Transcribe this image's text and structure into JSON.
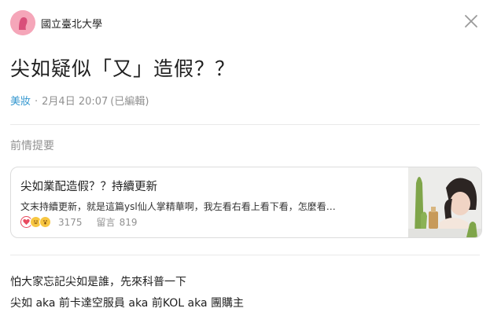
{
  "board": {
    "name": "國立臺北大學"
  },
  "post": {
    "title": "尖如疑似「又」造假？？",
    "category": "美妝",
    "separator": "·",
    "date": "2月4日 20:07",
    "edited": "(已編輯)"
  },
  "section": {
    "label": "前情提要"
  },
  "linked_post": {
    "title": "尖如業配造假？？持續更新",
    "excerpt": "文末持續更新，就是這篇ysl仙人掌精華啊，我左看右看上看下看，怎麼看…",
    "likes": "3175",
    "comments_label": "留言",
    "comments": "819"
  },
  "body": {
    "line1": "怕大家忘記尖如是誰，先來科普一下",
    "line2": "尖如 aka 前卡達空服員 aka 前KOL aka 團購主"
  },
  "colors": {
    "accent": "#3397cf",
    "muted": "#919191",
    "avatar": "#f5a6b9"
  }
}
